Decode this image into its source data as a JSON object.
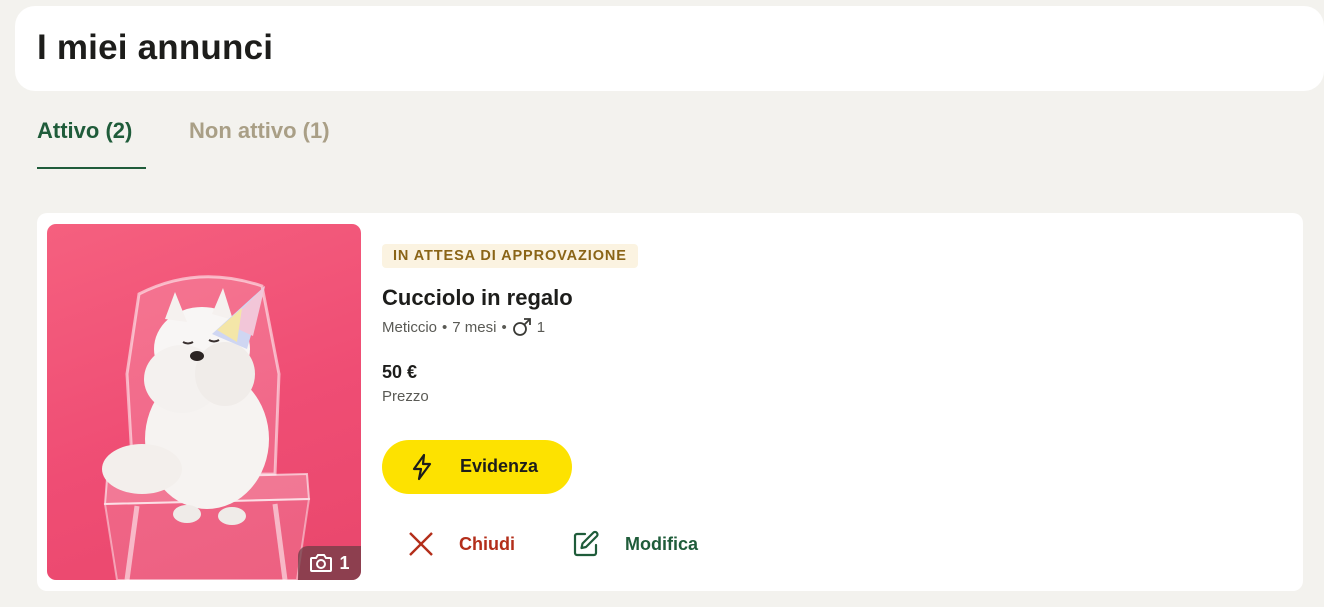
{
  "header": {
    "title": "I miei annunci"
  },
  "tabs": [
    {
      "label": "Attivo (2)",
      "active": true
    },
    {
      "label": "Non attivo (1)",
      "active": false
    }
  ],
  "listing": {
    "status": "IN ATTESA DI APPROVAZIONE",
    "title": "Cucciolo in regalo",
    "breed": "Meticcio",
    "separator": "•",
    "age": "7 mesi",
    "male_count": "1",
    "price": "50 €",
    "price_label": "Prezzo",
    "photo_count": "1",
    "boost_label": "Evidenza",
    "close_label": "Chiudi",
    "edit_label": "Modifica"
  },
  "icons": {
    "boost": "lightning-icon",
    "close": "close-icon",
    "edit": "edit-icon",
    "camera": "camera-icon",
    "male": "male-symbol-icon"
  },
  "colors": {
    "background": "#f3f2ee",
    "accent_green": "#1f5c3a",
    "inactive_tab": "#a99f86",
    "badge_bg": "#fbf3e1",
    "badge_text": "#8a6416",
    "boost_yellow": "#fde200",
    "close_red": "#b32e1a"
  }
}
